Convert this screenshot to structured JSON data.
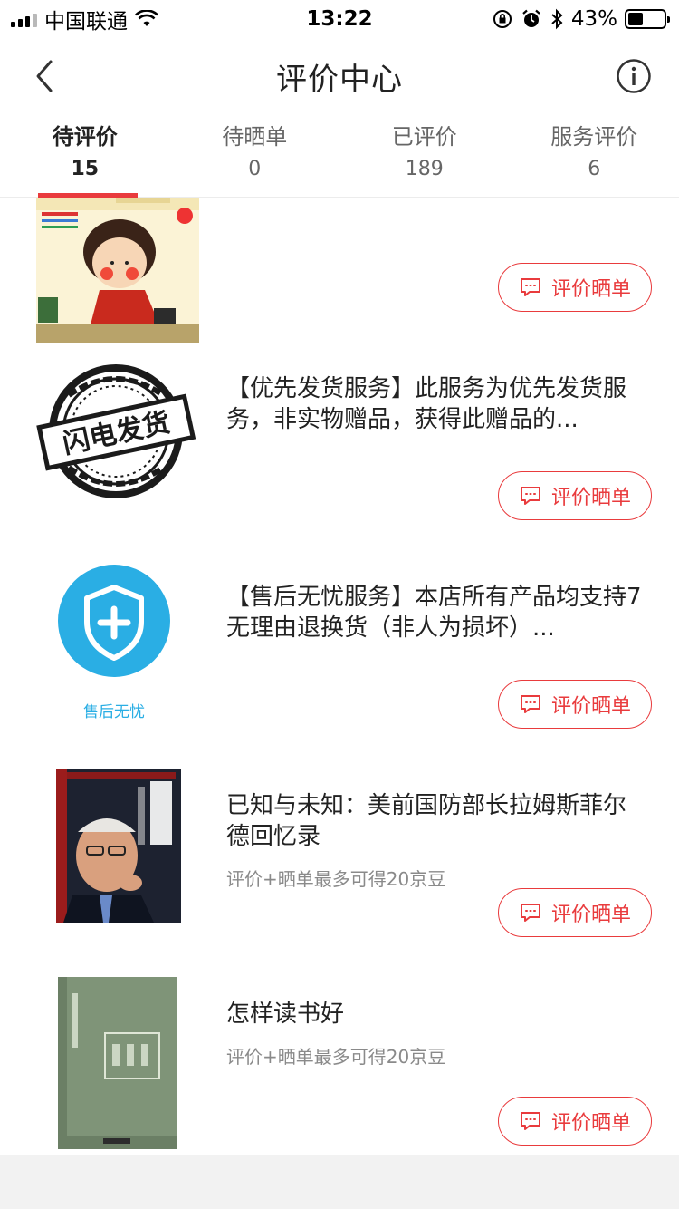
{
  "status_bar": {
    "carrier": "中国联通",
    "time": "13:22",
    "battery": "43%",
    "battery_level": 0.43
  },
  "nav": {
    "title": "评价中心",
    "back_icon": "chevron-left-icon",
    "info_icon": "info-icon"
  },
  "tabs": [
    {
      "label": "待评价",
      "count": "15",
      "active": true
    },
    {
      "label": "待晒单",
      "count": "0",
      "active": false
    },
    {
      "label": "已评价",
      "count": "189",
      "active": false
    },
    {
      "label": "服务评价",
      "count": "6",
      "active": false
    }
  ],
  "items": [
    {
      "title": "",
      "subtitle": "",
      "button": "评价晒单",
      "thumb_icon": "picture-book-cover"
    },
    {
      "title": "【优先发货服务】此服务为优先发货服务，非实物赠品，获得此赠品的...",
      "subtitle": "",
      "button": "评价晒单",
      "thumb_icon": "approved-stamp",
      "thumb_text": "闪电发货"
    },
    {
      "title": "【售后无忧服务】本店所有产品均支持7无理由退换货（非人为损坏）...",
      "subtitle": "",
      "button": "评价晒单",
      "thumb_icon": "shield-plus-icon",
      "thumb_caption": "售后无忧"
    },
    {
      "title": "已知与未知：美前国防部长拉姆斯菲尔德回忆录",
      "subtitle": "评价+晒单最多可得20京豆",
      "button": "评价晒单",
      "thumb_icon": "book-cover-dark"
    },
    {
      "title": "怎样读书好",
      "subtitle": "评价+晒单最多可得20京豆",
      "button": "评价晒单",
      "thumb_icon": "book-cover-green"
    }
  ],
  "colors": {
    "accent": "#e93b3d",
    "shield_blue": "#2aaee4"
  }
}
